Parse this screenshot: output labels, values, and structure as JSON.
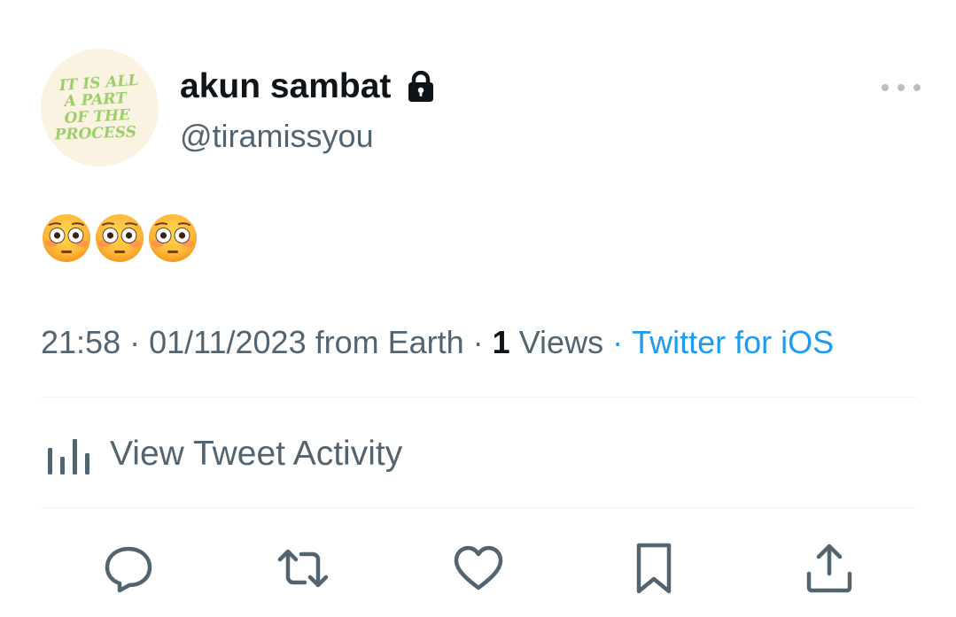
{
  "user": {
    "display_name": "akun sambat",
    "handle": "@tiramissyou",
    "protected_icon": "lock-icon",
    "avatar_text": [
      "IT IS ALL",
      "A PART",
      "OF THE",
      "PROCESS"
    ]
  },
  "tweet": {
    "text": "😳😳😳"
  },
  "meta": {
    "time": "21:58",
    "date": "01/11/2023",
    "location": "from Earth",
    "views_count": "1",
    "views_label": "Views",
    "source": "Twitter for iOS",
    "separator": "·"
  },
  "activity": {
    "label": "View Tweet Activity",
    "icon": "bar-chart-icon"
  },
  "actions": [
    "reply-icon",
    "retweet-icon",
    "like-icon",
    "bookmark-icon",
    "share-icon"
  ],
  "colors": {
    "text_primary": "#0f1419",
    "text_secondary": "#536471",
    "link": "#1d9bf0",
    "divider": "#eff3f4",
    "avatar_bg": "#fbf3e2",
    "avatar_text": "#9ccf6a"
  }
}
